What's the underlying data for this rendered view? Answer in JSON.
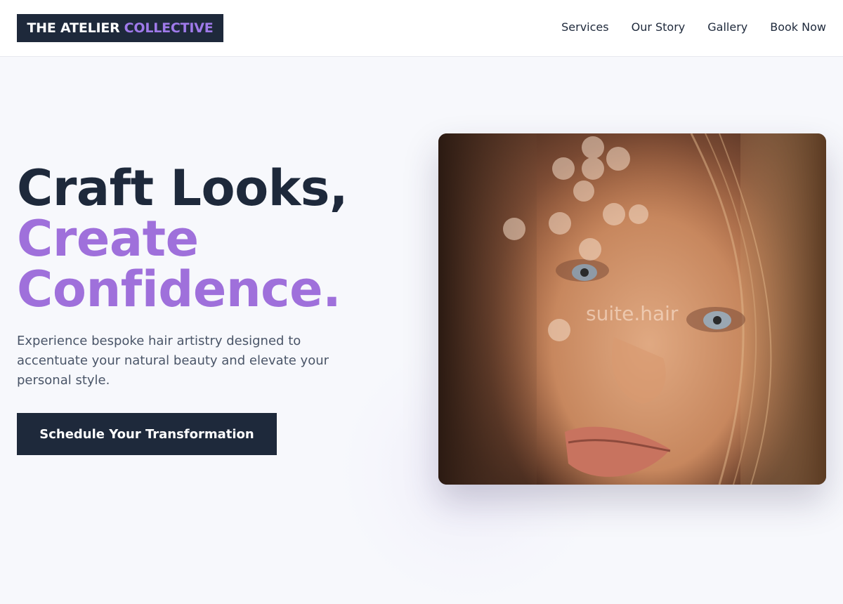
{
  "brand": {
    "name_part1": "THE ATELIER",
    "name_part2": "COLLECTIVE"
  },
  "nav": {
    "items": [
      {
        "label": "Services"
      },
      {
        "label": "Our Story"
      },
      {
        "label": "Gallery"
      },
      {
        "label": "Book Now"
      }
    ]
  },
  "hero": {
    "headline_line1": "Craft Looks,",
    "headline_line2": "Create",
    "headline_line3": "Confidence.",
    "subtext": "Experience bespoke hair artistry designed to accentuate your natural beauty and elevate your personal style.",
    "cta_label": "Schedule Your Transformation",
    "image_watermark": "suite.hair"
  },
  "colors": {
    "navy": "#1e293b",
    "accent_purple": "#9f70db",
    "background": "#f7f8fc",
    "body_text": "#4a5568"
  }
}
